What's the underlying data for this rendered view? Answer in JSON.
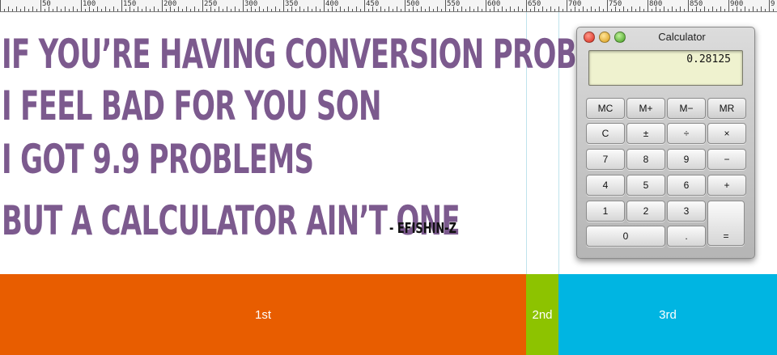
{
  "ruler": {
    "labels": [
      "50",
      "100",
      "150",
      "200",
      "250",
      "300",
      "350",
      "400",
      "450",
      "500",
      "550",
      "600",
      "650",
      "700",
      "750",
      "800",
      "850",
      "900",
      "9"
    ]
  },
  "poster": {
    "lines": [
      "IF YOU’RE HAVING CONVERSION PROBLEMS",
      "I FEEL BAD FOR YOU SON",
      "I GOT 9.9 PROBLEMS",
      "BUT A CALCULATOR AIN’T ONE"
    ],
    "credit": "- EFISHIN-Z",
    "text_color": "#7c5a8e"
  },
  "bands": [
    {
      "label": "1st",
      "color": "#e85d00"
    },
    {
      "label": "2nd",
      "color": "#8dc300"
    },
    {
      "label": "3rd",
      "color": "#00b5e2"
    }
  ],
  "calculator": {
    "title": "Calculator",
    "display": "0.28125",
    "keys": {
      "mc": "MC",
      "mplus": "M+",
      "mminus": "M−",
      "mr": "MR",
      "clear": "C",
      "plusminus": "±",
      "divide": "÷",
      "multiply": "×",
      "k7": "7",
      "k8": "8",
      "k9": "9",
      "minus": "−",
      "k4": "4",
      "k5": "5",
      "k6": "6",
      "plus": "+",
      "k1": "1",
      "k2": "2",
      "k3": "3",
      "equals": "=",
      "k0": "0",
      "decimal": "."
    }
  }
}
